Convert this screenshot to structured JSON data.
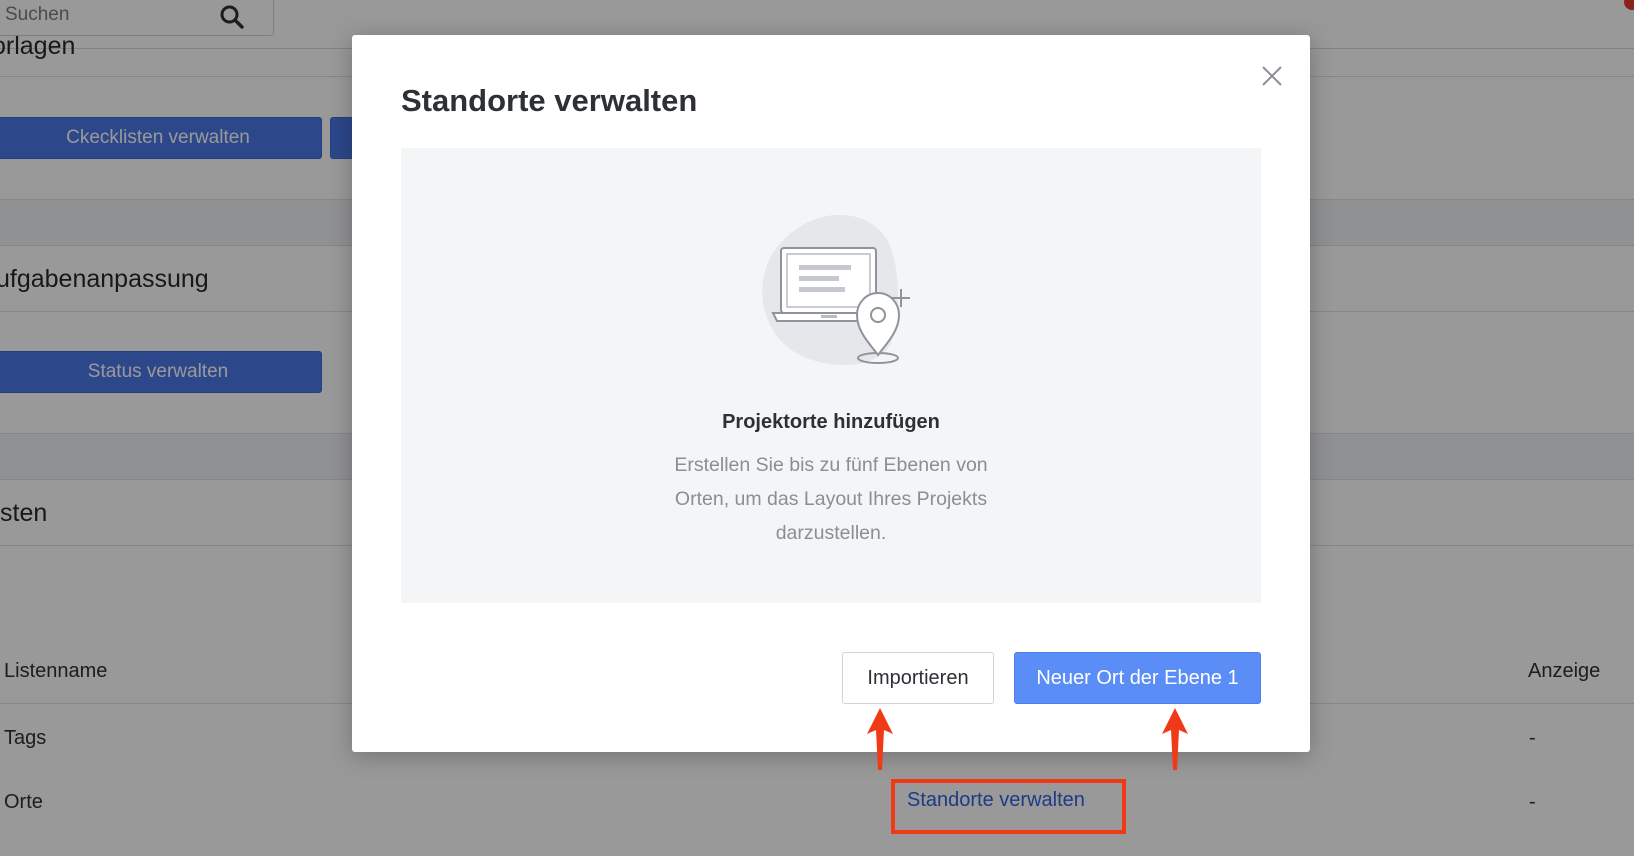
{
  "search": {
    "placeholder": "Suchen"
  },
  "sections": [
    {
      "title": "orlagen",
      "buttons": [
        "Ckecklisten verwalten",
        ""
      ]
    },
    {
      "title": "ufgabenanpassung",
      "buttons": [
        "Status verwalten"
      ]
    },
    {
      "title": "sten"
    }
  ],
  "lists_table": {
    "columns": [
      "Listenname",
      "Anzeige"
    ],
    "rows": [
      {
        "name": "Tags",
        "action": "",
        "display": "-"
      },
      {
        "name": "Orte",
        "action": "Standorte verwalten",
        "display": "-"
      }
    ]
  },
  "modal": {
    "title": "Standorte verwalten",
    "empty_title": "Projektorte hinzufügen",
    "empty_description": "Erstellen Sie bis zu fünf Ebenen von Orten, um das Layout Ihres Projekts darzustellen.",
    "import_label": "Importieren",
    "new_label": "Neuer Ort der Ebene 1"
  },
  "icons": {
    "search": "search-icon",
    "close": "close-icon",
    "illustration": "laptop-location-pin-illustration",
    "arrows": "annotation-arrow-icon"
  },
  "colors": {
    "primary": "#5b8df6",
    "bg_button": "#4a78e8",
    "link": "#2e64e0",
    "annotation": "#f03a17",
    "notification": "#e53b2c"
  }
}
